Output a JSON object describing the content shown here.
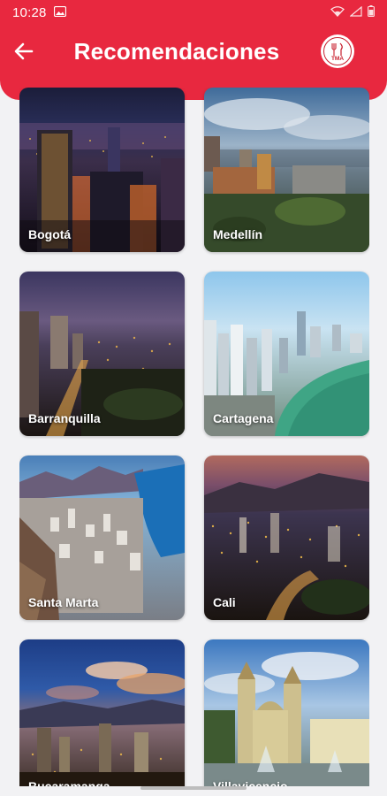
{
  "status_bar": {
    "time": "10:28"
  },
  "header": {
    "title": "Recomendaciones",
    "back_icon": "arrow-left-icon",
    "logo_text": "TMA",
    "colors": {
      "primary": "#e8283f",
      "background": "#f2f2f4"
    }
  },
  "cities": [
    {
      "label": "Bogotá",
      "scene": "night-city"
    },
    {
      "label": "Medellín",
      "scene": "cloudy-city"
    },
    {
      "label": "Barranquilla",
      "scene": "dusk-city"
    },
    {
      "label": "Cartagena",
      "scene": "coast-city"
    },
    {
      "label": "Santa Marta",
      "scene": "bay-city"
    },
    {
      "label": "Cali",
      "scene": "valley-night"
    },
    {
      "label": "Bucaramanga",
      "scene": "sunset-city"
    },
    {
      "label": "Villavicencio",
      "scene": "cathedral"
    }
  ]
}
